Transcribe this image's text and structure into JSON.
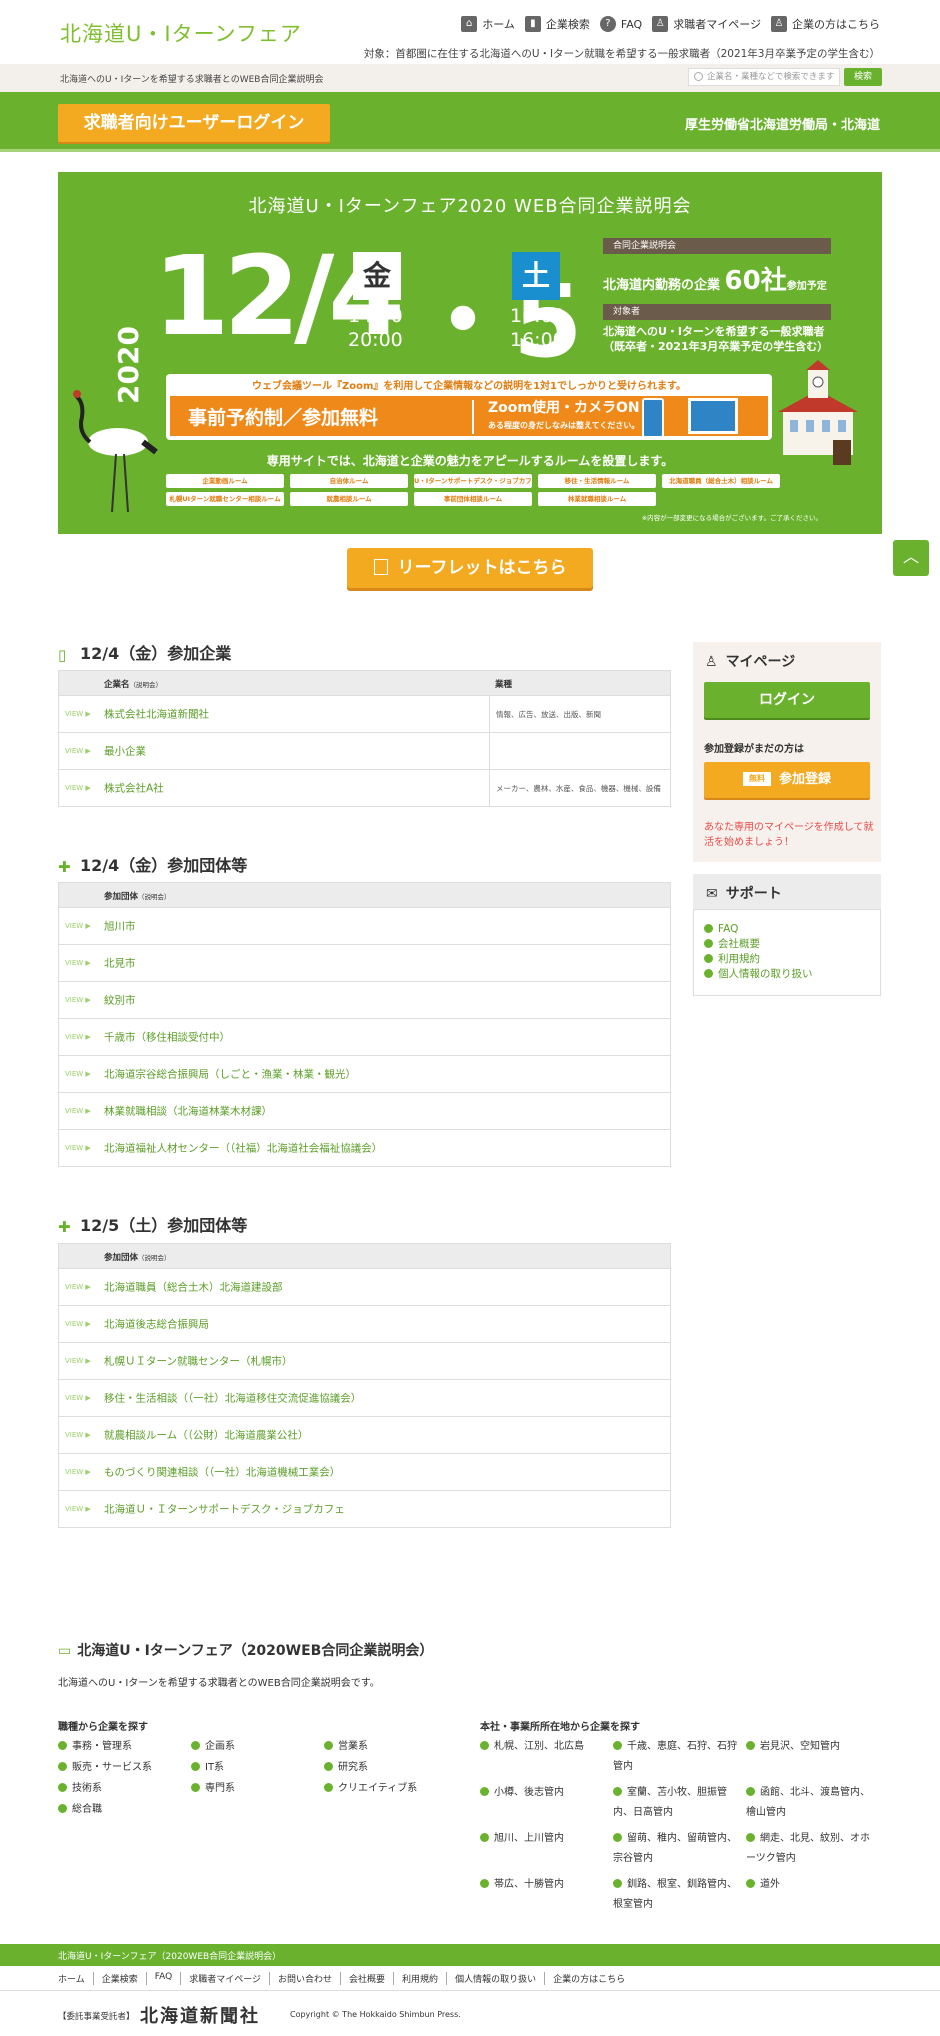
{
  "header": {
    "logo": "北海道U・Iターンフェア",
    "nav": [
      {
        "label": "ホーム",
        "icon": "home-icon"
      },
      {
        "label": "企業検索",
        "icon": "building-icon"
      },
      {
        "label": "FAQ",
        "icon": "question-icon"
      },
      {
        "label": "求職者マイページ",
        "icon": "user-icon"
      },
      {
        "label": "企業の方はこちら",
        "icon": "user-icon"
      }
    ],
    "target": "対象：首都圏に在住する北海道へのU・Iターン就職を希望する一般求職者（2021年3月卒業予定の学生含む）",
    "subtext": "北海道へのU・Iターンを希望する求職者とのWEB合同企業説明会",
    "search_placeholder": "企業名・業種などで検索できます",
    "search_button": "検索",
    "login_button": "求職者向けユーザーログイン",
    "ministry": "厚生労働省北海道労働局・北海道"
  },
  "banner": {
    "title": "北海道U・Iターンフェア2020 WEB合同企業説明会",
    "year": "2020",
    "date1": "12/4",
    "day1": "金",
    "time1_start": "14:00",
    "time1_end": "20:00",
    "date2": "・5",
    "day2": "土",
    "time2_start": "10:00",
    "time2_end": "16:00",
    "label1": "合同企業説明会",
    "value1_pre": "北海道内勤務の企業",
    "value1_num": "60社",
    "value1_post": "参加予定",
    "label2": "対象者",
    "value2_line1": "北海道へのU・Iターンを希望する一般求職者",
    "value2_line2": "（既卒者・2021年3月卒業予定の学生含む）",
    "zoom_head": "ウェブ会議ツール『Zoom』を利用して企業情報などの説明を1対1でしっかりと受けられます。",
    "reserve": "事前予約制／参加無料",
    "zoom_main": "Zoom使用・カメラON",
    "zoom_sub": "ある程度の身だしなみは整えてください。",
    "site_text": "専用サイトでは、北海道と企業の魅力をアピールするルームを設置します。",
    "rooms": [
      "企業動画ルーム",
      "自治体ルーム",
      "U・Iターンサポートデスク・ジョブカフェ",
      "移住・生活情報ルーム",
      "北海道職員（総合土木）相談ルーム",
      "札幌UIターン就職センター相談ルーム",
      "就農相談ルーム",
      "事前団体相談ルーム",
      "林業就職相談ルーム"
    ],
    "note": "※内容が一部変更になる場合がございます。ご了承ください。"
  },
  "leaflet_button": "リーフレットはこちら",
  "section1": {
    "title": "12/4（金）参加企業",
    "col_name": "企業名",
    "col_name_sub": "（説明会）",
    "col_industry": "業種",
    "rows": [
      {
        "name": "株式会社北海道新聞社",
        "industry": "情報、広告、放送、出版、新聞"
      },
      {
        "name": "最小企業",
        "industry": ""
      },
      {
        "name": "株式会社A社",
        "industry": "メーカー、農林、水産、食品、機器、機械、設備"
      }
    ]
  },
  "section2": {
    "title": "12/4（金）参加団体等",
    "col": "参加団体",
    "col_sub": "（説明会）",
    "rows": [
      "旭川市",
      "北見市",
      "紋別市",
      "千歳市（移住相談受付中）",
      "北海道宗谷総合振興局（しごと・漁業・林業・観光）",
      "林業就職相談（北海道林業木材課）",
      "北海道福祉人材センター（（社福）北海道社会福祉協議会）"
    ]
  },
  "section3": {
    "title": "12/5（土）参加団体等",
    "col": "参加団体",
    "col_sub": "（説明会）",
    "rows": [
      "北海道職員（総合土木）北海道建設部",
      "北海道後志総合振興局",
      "札幌ＵＩターン就職センター（札幌市）",
      "移住・生活相談（（一社）北海道移住交流促進協議会）",
      "就農相談ルーム（（公財）北海道農業公社）",
      "ものづくり関連相談（（一社）北海道機械工業会）",
      "北海道Ｕ・Ｉターンサポートデスク・ジョブカフェ"
    ]
  },
  "row_arrow": "VIEW ▶",
  "sidebar": {
    "mypage_title": "マイページ",
    "login": "ログイン",
    "register_q": "参加登録がまだの方は",
    "free": "無料",
    "register": "参加登録",
    "message": "あなた専用のマイページを作成して就活を始めましょう！",
    "support_title": "サポート",
    "support_links": [
      "FAQ",
      "会社概要",
      "利用規約",
      "個人情報の取り扱い"
    ]
  },
  "footer": {
    "title": "北海道U・Iターンフェア（2020WEB合同企業説明会）",
    "desc": "北海道へのU・Iターンを希望する求職者とのWEB合同企業説明会です。",
    "jobs_heading": "職種から企業を探す",
    "jobs": [
      "事務・管理系",
      "企画系",
      "営業系",
      "販売・サービス系",
      "IT系",
      "研究系",
      "技術系",
      "専門系",
      "クリエイティブ系",
      "総合職"
    ],
    "areas_heading": "本社・事業所所在地から企業を探す",
    "areas": [
      "札幌、江別、北広島",
      "千歳、恵庭、石狩、石狩管内",
      "岩見沢、空知管内",
      "小樽、後志管内",
      "室蘭、苫小牧、胆振管内、日高管内",
      "函館、北斗、渡島管内、檜山管内",
      "旭川、上川管内",
      "留萌、稚内、留萌管内、宗谷管内",
      "網走、北見、紋別、オホーツク管内",
      "帯広、十勝管内",
      "釧路、根室、釧路管内、根室管内",
      "道外"
    ],
    "band": "北海道U・Iターンフェア（2020WEB合同企業説明会）",
    "links": [
      "ホーム",
      "企業検索",
      "FAQ",
      "求職者マイページ",
      "お問い合わせ",
      "会社概要",
      "利用規約",
      "個人情報の取り扱い",
      "企業の方はこちら"
    ],
    "client_label": "【委託事業受託者】",
    "client_logo": "北海道新聞社",
    "copyright": "Copyright © The Hokkaido Shimbun Press."
  }
}
